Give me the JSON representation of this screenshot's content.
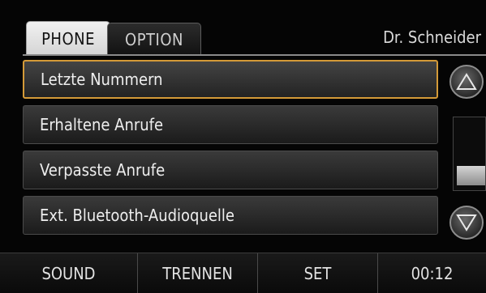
{
  "tabs": {
    "phone": "PHONE",
    "option": "OPTION"
  },
  "user": {
    "name": "Dr. Schneider"
  },
  "list": {
    "items": [
      {
        "label": "Letzte Nummern",
        "selected": true
      },
      {
        "label": "Erhaltene Anrufe",
        "selected": false
      },
      {
        "label": "Verpasste Anrufe",
        "selected": false
      },
      {
        "label": "Ext. Bluetooth-Audioquelle",
        "selected": false
      }
    ]
  },
  "scroll": {
    "up_icon": "triangle-up-icon",
    "down_icon": "triangle-down-icon",
    "position": 1.0
  },
  "bottom": {
    "sound": "SOUND",
    "trennen": "TRENNEN",
    "set": "SET",
    "time": "00:12"
  },
  "colors": {
    "selection_border": "#d49a38",
    "background": "#050505"
  }
}
